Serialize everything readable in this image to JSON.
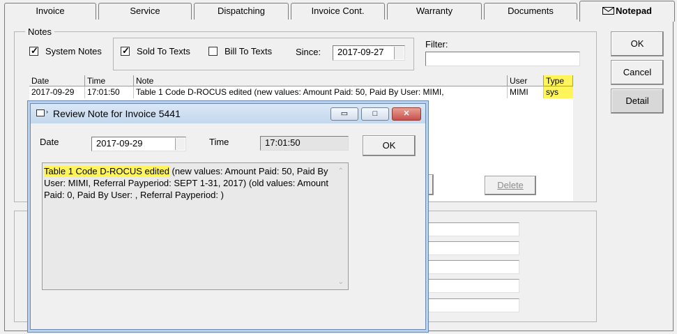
{
  "tabs": [
    {
      "label": "Invoice"
    },
    {
      "label": "Service"
    },
    {
      "label": "Dispatching"
    },
    {
      "label": "Invoice Cont."
    },
    {
      "label": "Warranty"
    },
    {
      "label": "Documents"
    },
    {
      "label": "Notepad",
      "icon": "envelope-icon"
    }
  ],
  "notes_group": {
    "title": "Notes",
    "system_notes": {
      "label": "System Notes",
      "checked": true
    },
    "sold_to_texts": {
      "label": "Sold To Texts",
      "checked": true
    },
    "bill_to_texts": {
      "label": "Bill To Texts",
      "checked": false
    },
    "since_label": "Since:",
    "since_value": "2017-09-27",
    "filter_label": "Filter:",
    "filter_value": ""
  },
  "notes_table": {
    "headers": [
      "Date",
      "Time",
      "Note",
      "User",
      "Type"
    ],
    "rows": [
      [
        "2017-09-29",
        "17:01:50",
        "Table 1 Code D-ROCUS edited (new values: Amount Paid: 50, Paid By User: MIMI,",
        "MIMI",
        "sys"
      ]
    ]
  },
  "buttons": {
    "ok": "OK",
    "cancel": "Cancel",
    "detail": "Detail",
    "delete": "Delete"
  },
  "dialog": {
    "title": "Review Note for Invoice 5441",
    "date_label": "Date",
    "date_value": "2017-09-29",
    "time_label": "Time",
    "time_value": "17:01:50",
    "ok_label": "OK",
    "note_highlight": "Table 1 Code D-ROCUS edited",
    "note_rest": " (new values: Amount Paid: 50, Paid By User: MIMI, Referral Payperiod: SEPT 1-31, 2017) (old values: Amount Paid: 0, Paid By User: , Referral Payperiod: )",
    "window_buttons": {
      "minimize": "▭",
      "maximize": "□",
      "close": "✕"
    }
  },
  "colors": {
    "highlight": "#fff55a",
    "title_gradient_top": "#dbe8f5",
    "close_red": "#c75050"
  }
}
